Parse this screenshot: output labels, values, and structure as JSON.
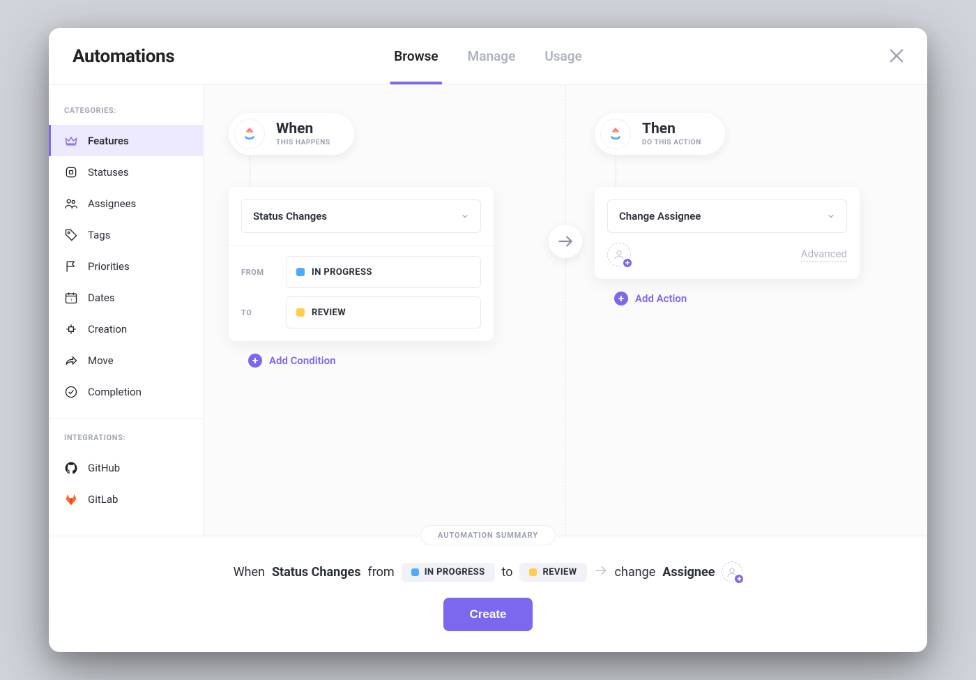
{
  "header": {
    "title": "Automations",
    "tabs": [
      {
        "id": "browse",
        "label": "Browse",
        "active": true
      },
      {
        "id": "manage",
        "label": "Manage",
        "active": false
      },
      {
        "id": "usage",
        "label": "Usage",
        "active": false
      }
    ]
  },
  "sidebar": {
    "categories_label": "CATEGORIES:",
    "integrations_label": "INTEGRATIONS:",
    "categories": [
      {
        "id": "features",
        "label": "Features",
        "icon": "crown",
        "active": true
      },
      {
        "id": "statuses",
        "label": "Statuses",
        "icon": "square",
        "active": false
      },
      {
        "id": "assignees",
        "label": "Assignees",
        "icon": "people",
        "active": false
      },
      {
        "id": "tags",
        "label": "Tags",
        "icon": "tag",
        "active": false
      },
      {
        "id": "priorities",
        "label": "Priorities",
        "icon": "flag",
        "active": false
      },
      {
        "id": "dates",
        "label": "Dates",
        "icon": "calendar",
        "active": false
      },
      {
        "id": "creation",
        "label": "Creation",
        "icon": "plus",
        "active": false
      },
      {
        "id": "move",
        "label": "Move",
        "icon": "share",
        "active": false
      },
      {
        "id": "completion",
        "label": "Completion",
        "icon": "check",
        "active": false
      }
    ],
    "integrations": [
      {
        "id": "github",
        "label": "GitHub",
        "icon": "github"
      },
      {
        "id": "gitlab",
        "label": "GitLab",
        "icon": "gitlab"
      }
    ]
  },
  "when": {
    "title": "When",
    "subtitle": "THIS HAPPENS",
    "selector_label": "Status Changes",
    "from_label": "FROM",
    "to_label": "TO",
    "from_status": {
      "name": "IN PROGRESS",
      "color": "#4dabf7"
    },
    "to_status": {
      "name": "REVIEW",
      "color": "#ffcc4d"
    },
    "add_condition_label": "Add Condition"
  },
  "then": {
    "title": "Then",
    "subtitle": "DO THIS ACTION",
    "selector_label": "Change Assignee",
    "advanced_label": "Advanced",
    "add_action_label": "Add Action"
  },
  "summary": {
    "badge": "AUTOMATION SUMMARY",
    "text": {
      "when": "When",
      "status_changes": "Status Changes",
      "from": "from",
      "to": "to",
      "change": "change",
      "assignee": "Assignee"
    },
    "create_label": "Create"
  },
  "colors": {
    "accent": "#7b68ee",
    "status_blue": "#4dabf7",
    "status_yellow": "#ffcc4d"
  }
}
